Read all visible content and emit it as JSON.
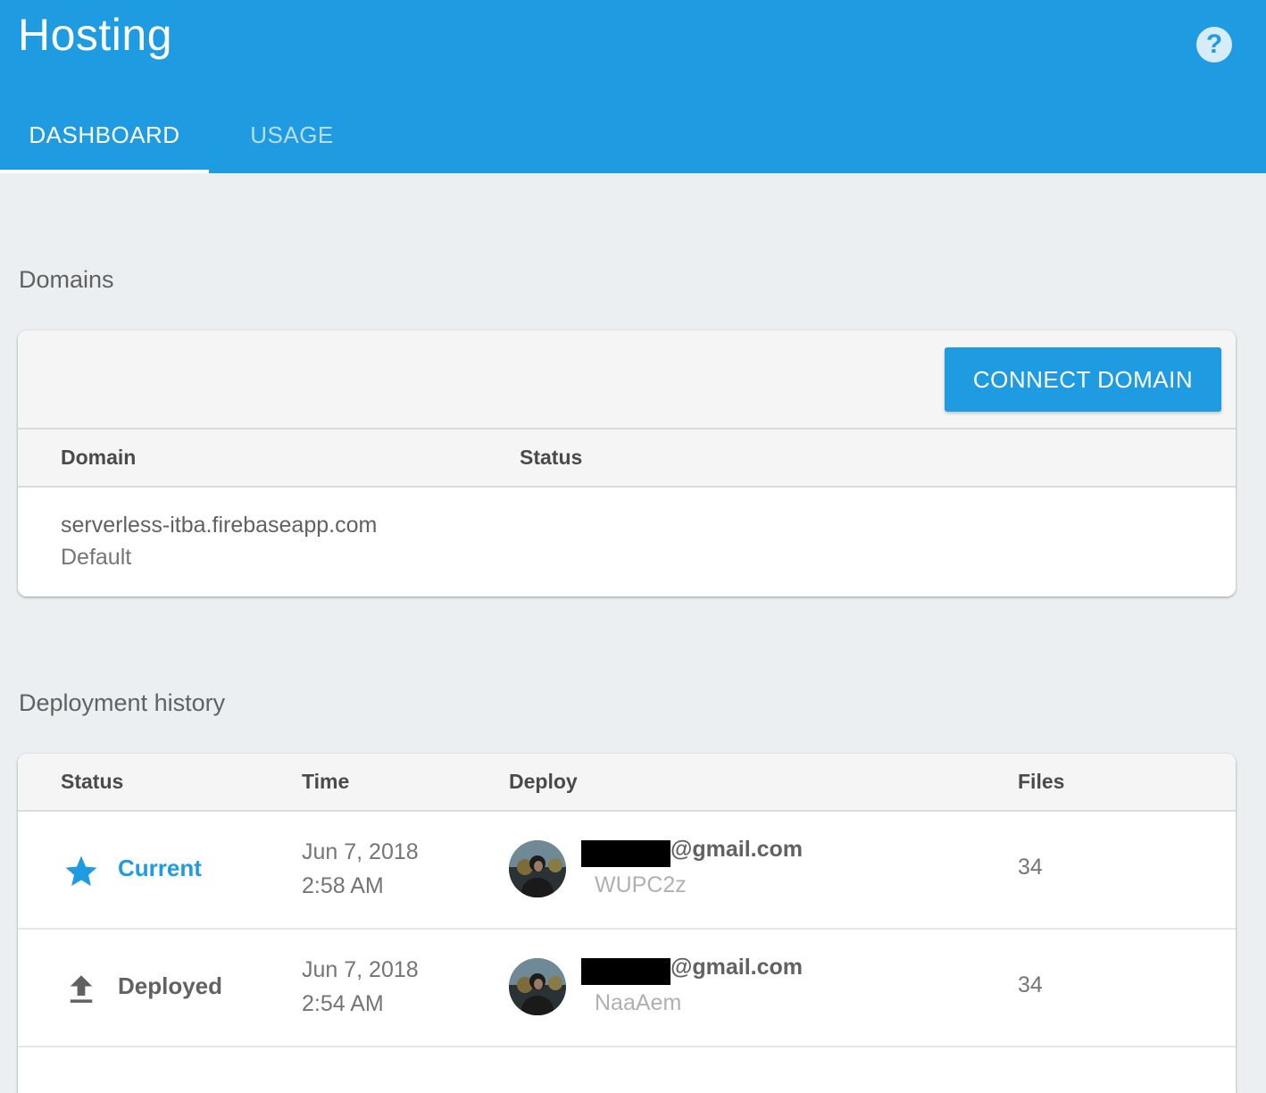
{
  "header": {
    "title": "Hosting",
    "help_symbol": "?",
    "tabs": [
      {
        "label": "DASHBOARD",
        "active": true
      },
      {
        "label": "USAGE",
        "active": false
      }
    ]
  },
  "domains": {
    "section_title": "Domains",
    "connect_button": "CONNECT DOMAIN",
    "columns": [
      "Domain",
      "Status"
    ],
    "rows": [
      {
        "domain": "serverless-itba.firebaseapp.com",
        "sub": "Default",
        "status": ""
      }
    ]
  },
  "deployments": {
    "section_title": "Deployment history",
    "columns": [
      "Status",
      "Time",
      "Deploy",
      "Files"
    ],
    "rows": [
      {
        "status": "Current",
        "status_icon": "star-icon",
        "date": "Jun 7, 2018",
        "time": "2:58 AM",
        "email": "@gmail.com",
        "deploy_id": "WUPC2z",
        "files": "34"
      },
      {
        "status": "Deployed",
        "status_icon": "upload-icon",
        "date": "Jun 7, 2018",
        "time": "2:54 AM",
        "email": "@gmail.com",
        "deploy_id": "NaaAem",
        "files": "34"
      }
    ]
  },
  "colors": {
    "brand_blue": "#1e9be1",
    "page_bg": "#eceff1"
  }
}
